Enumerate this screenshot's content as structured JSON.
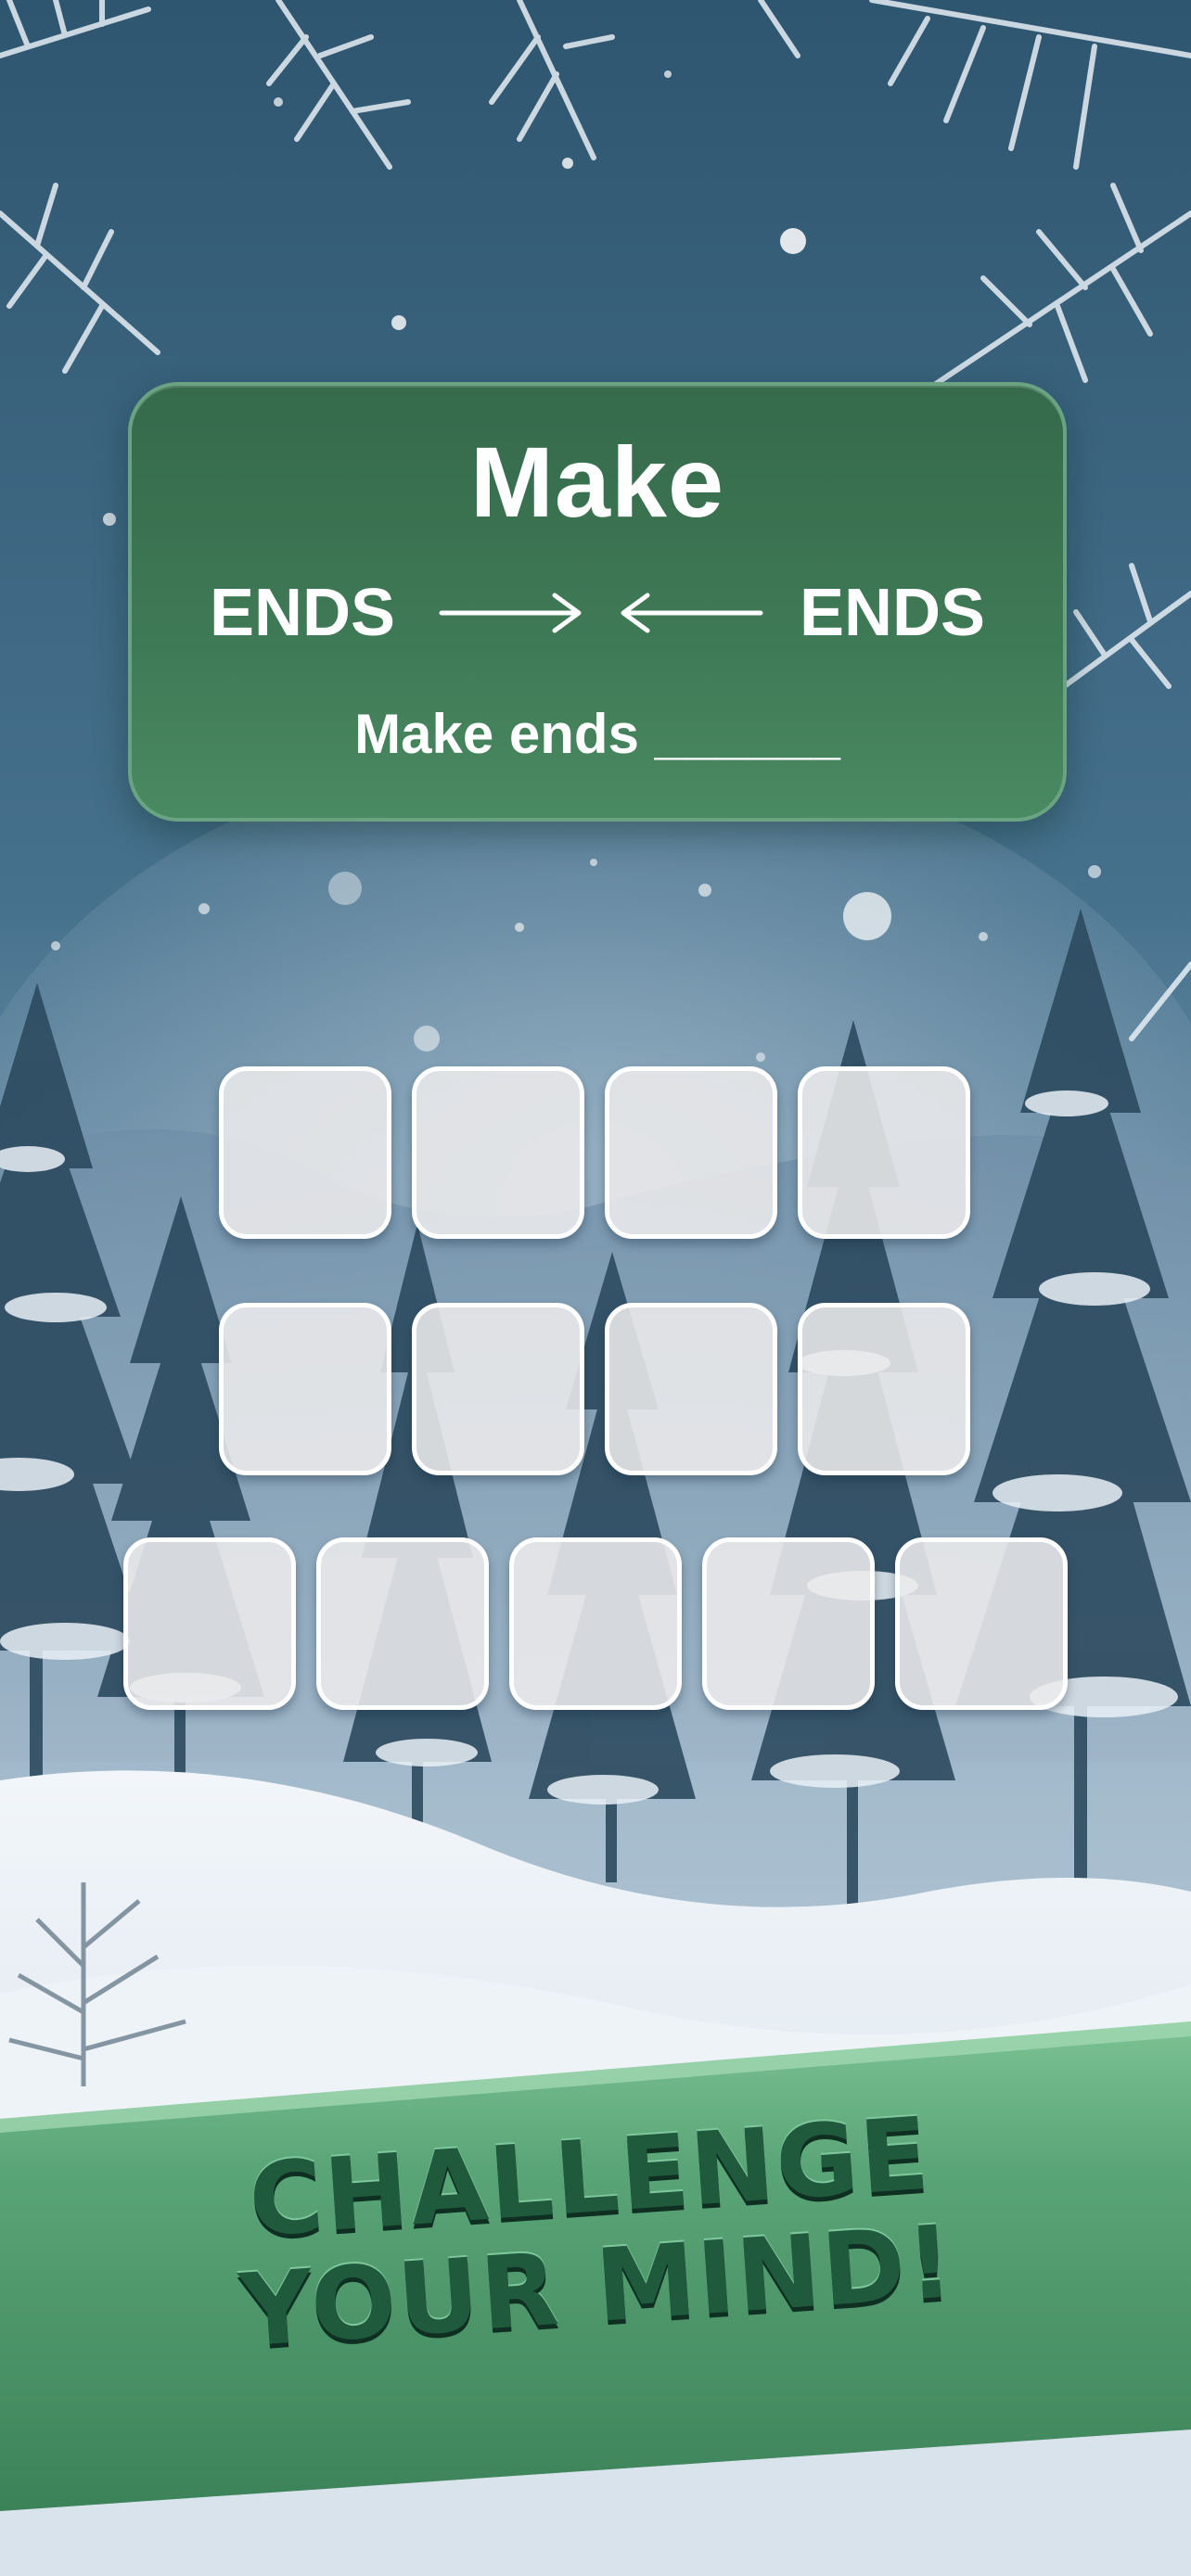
{
  "clue": {
    "title": "Make",
    "left_word": "ENDS",
    "right_word": "ENDS",
    "sentence": "Make ends ______"
  },
  "board": {
    "rows": [
      {
        "tiles": [
          "",
          "",
          "",
          ""
        ]
      },
      {
        "tiles": [
          "",
          "",
          "",
          ""
        ]
      },
      {
        "tiles": [
          "",
          "",
          "",
          "",
          ""
        ]
      }
    ]
  },
  "banner": {
    "line1": "CHALLENGE",
    "line2": "YOUR MIND!"
  },
  "colors": {
    "card_green": "#3f7a56",
    "banner_green": "#4e9a6a",
    "banner_text": "#1f5a3d",
    "sky": "#3b6785",
    "snow": "#e8eef4"
  },
  "icons": [
    "arrow-right-icon",
    "arrow-left-icon"
  ]
}
